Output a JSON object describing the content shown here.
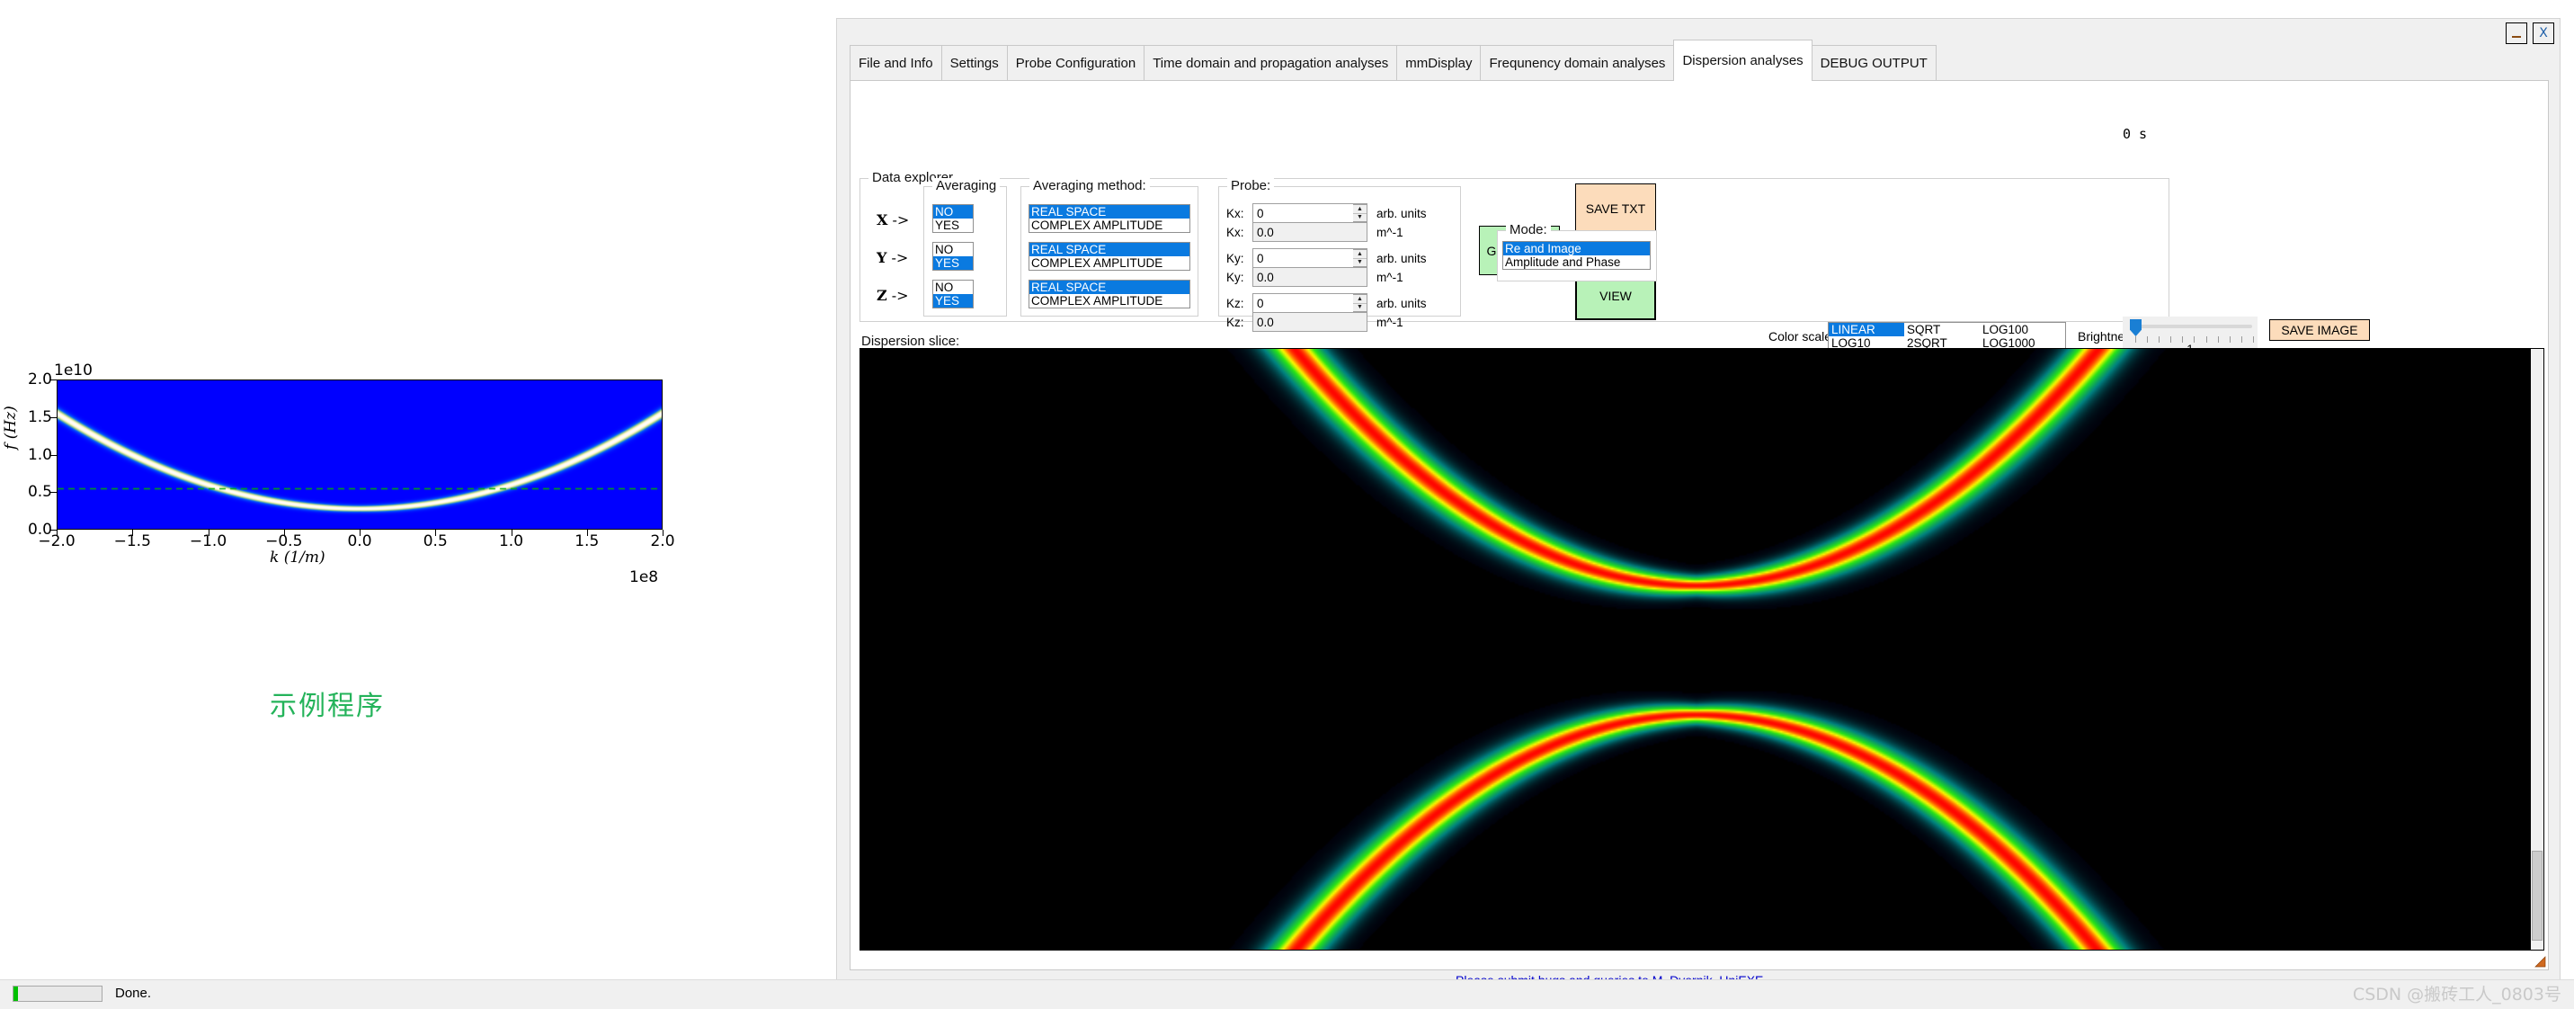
{
  "window": {
    "minimize_label": "_",
    "close_label": "X",
    "time_label": "0 s"
  },
  "tabs": [
    {
      "label": "File and Info",
      "active": false
    },
    {
      "label": "Settings",
      "active": false
    },
    {
      "label": "Probe Configuration",
      "active": false
    },
    {
      "label": "Time domain and propagation analyses",
      "active": false
    },
    {
      "label": "mmDisplay",
      "active": false
    },
    {
      "label": "Frequnency domain analyses",
      "active": false
    },
    {
      "label": "Dispersion analyses",
      "active": true
    },
    {
      "label": "DEBUG OUTPUT",
      "active": false
    }
  ],
  "data_explorer": {
    "title": "Data explorer",
    "averaging_title": "Averaging",
    "averaging_method_title": "Averaging method:",
    "rows": [
      {
        "axis": "X",
        "arrow": "->",
        "averaging": [
          "NO",
          "YES"
        ],
        "averaging_selected": "NO",
        "method": [
          "REAL SPACE",
          "COMPLEX AMPLITUDE"
        ],
        "method_selected": "REAL SPACE"
      },
      {
        "axis": "Y",
        "arrow": "->",
        "averaging": [
          "NO",
          "YES"
        ],
        "averaging_selected": "YES",
        "method": [
          "REAL SPACE",
          "COMPLEX AMPLITUDE"
        ],
        "method_selected": "REAL SPACE"
      },
      {
        "axis": "Z",
        "arrow": "->",
        "averaging": [
          "NO",
          "YES"
        ],
        "averaging_selected": "YES",
        "method": [
          "REAL SPACE",
          "COMPLEX AMPLITUDE"
        ],
        "method_selected": "REAL SPACE"
      }
    ]
  },
  "probe": {
    "title": "Probe:",
    "fields": [
      {
        "label": "Kx:",
        "value": "0",
        "unit": "arb. units",
        "readonly": false
      },
      {
        "label": "Kx:",
        "value": "0.0",
        "unit": "m^-1",
        "readonly": true
      },
      {
        "label": "Ky:",
        "value": "0",
        "unit": "arb. units",
        "readonly": false
      },
      {
        "label": "Ky:",
        "value": "0.0",
        "unit": "m^-1",
        "readonly": true
      },
      {
        "label": "Kz:",
        "value": "0",
        "unit": "arb. units",
        "readonly": false
      },
      {
        "label": "Kz:",
        "value": "0.0",
        "unit": "m^-1",
        "readonly": true
      }
    ]
  },
  "actions": {
    "get_slice": "GET SLICE",
    "save_txt": "SAVE TXT",
    "view": "VIEW",
    "save_image": "SAVE IMAGE"
  },
  "mode": {
    "title": "Mode:",
    "options": [
      "Re and Image",
      "Amplitude and Phase"
    ],
    "selected": "Re and Image"
  },
  "color_scale": {
    "label": "Color scale:",
    "options": [
      "LINEAR",
      "SQRT",
      "LOG100",
      "LOG10",
      "2SQRT",
      "LOG1000"
    ],
    "selected": "LINEAR"
  },
  "brightness": {
    "label": "Brightness:",
    "value": "1",
    "min": 1,
    "max": 10
  },
  "dispersion": {
    "label": "Dispersion slice:"
  },
  "footer": {
    "link": "Please submit bugs and queries to M. Dvornik, UniEXE"
  },
  "statusbar": {
    "progress_percent": 5,
    "text": "Done."
  },
  "watermark": "CSDN @搬砖工人_0803号",
  "caption_cn": "示例程序",
  "chart_data": {
    "type": "heatmap",
    "title": "",
    "xlabel": "k (1/m)",
    "ylabel": "f (Hz)",
    "x_exponent": "1e8",
    "y_exponent": "1e10",
    "xlim": [
      -2.0,
      2.0
    ],
    "ylim": [
      0.0,
      2.0
    ],
    "xticks": [
      "-2.0",
      "-1.5",
      "-1.0",
      "-0.5",
      "0.0",
      "0.5",
      "1.0",
      "1.5",
      "2.0"
    ],
    "xtick_values": [
      -2.0,
      -1.5,
      -1.0,
      -0.5,
      0.0,
      0.5,
      1.0,
      1.5,
      2.0
    ],
    "yticks": [
      "0.0",
      "0.5",
      "1.0",
      "1.5",
      "2.0"
    ],
    "ytick_values": [
      0.0,
      0.5,
      1.0,
      1.5,
      2.0
    ],
    "grid": false,
    "background_color": "#0000ff",
    "annotation_line": {
      "type": "hline",
      "y": 0.55,
      "color": "#00b000",
      "style": "dashed"
    },
    "dispersion_curve": {
      "description": "parabolic spin-wave dispersion minimum near k=0",
      "vertex": [
        0.0,
        0.27
      ],
      "points_k": [
        -2.0,
        -1.5,
        -1.0,
        -0.5,
        0.0,
        0.5,
        1.0,
        1.5,
        2.0
      ],
      "points_f": [
        1.55,
        1.05,
        0.68,
        0.36,
        0.27,
        0.36,
        0.68,
        1.05,
        1.55
      ]
    }
  }
}
